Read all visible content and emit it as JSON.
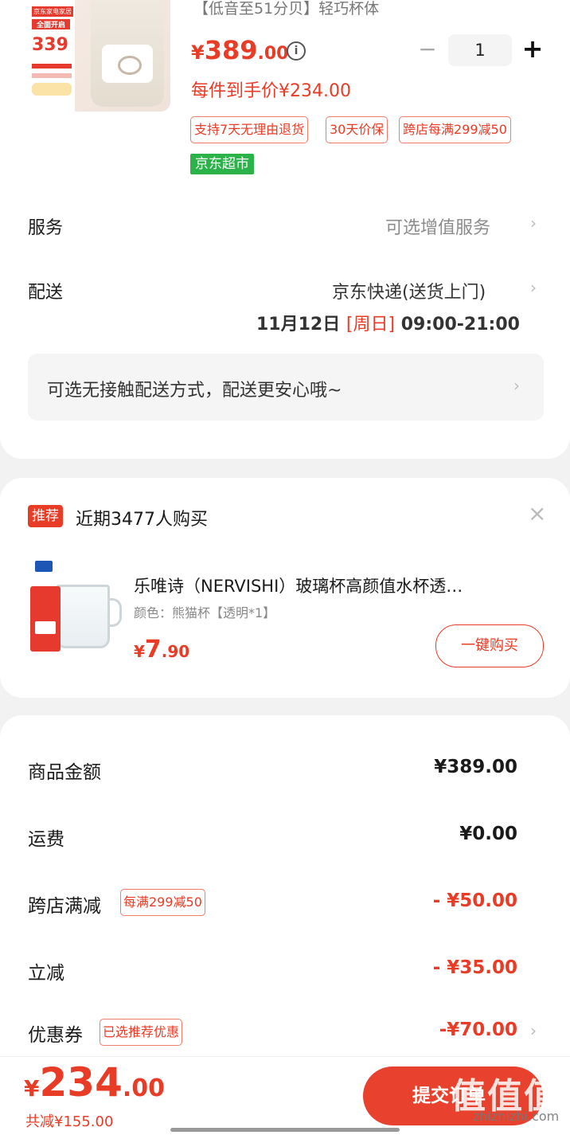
{
  "product": {
    "thumb_badges": [
      "京东家电家居",
      "全面开启",
      "339"
    ],
    "name_tail": "【低音至51分贝】轻巧杯体",
    "price_currency": "¥",
    "price_int": "389",
    "price_dec": ".00",
    "info_icon": "ⓘ",
    "minus": "−",
    "quantity": "1",
    "plus": "+",
    "unit_price": "每件到手价¥234.00",
    "tags": [
      "支持7天无理由退货",
      "30天价保",
      "跨店每满299减50"
    ],
    "market_tag": "京东超市"
  },
  "service": {
    "label": "服务",
    "value": "可选增值服务",
    "chevron": "›"
  },
  "delivery": {
    "label": "配送",
    "method": "京东快递(送货上门)",
    "date": "11月12日",
    "weekday": "[周日]",
    "time": "09:00-21:00",
    "chevron": "›"
  },
  "no_contact": {
    "text": "可选无接触配送方式，配送更安心哦~",
    "chevron": "›"
  },
  "recommend": {
    "badge": "推荐",
    "title": "近期3477人购买",
    "close": "×",
    "item_title": "乐唯诗（NERVISHI）玻璃杯高颜值水杯透…",
    "item_spec": "颜色：熊猫杯【透明*1】",
    "item_price_cur": "¥",
    "item_price_int": "7",
    "item_price_dec": ".90",
    "buy_button": "一键购买"
  },
  "summary": {
    "goods_label": "商品金额",
    "goods_value": "¥389.00",
    "shipping_label": "运费",
    "shipping_value": "¥0.00",
    "cross_label": "跨店满减",
    "cross_tag": "每满299减50",
    "cross_value": "- ¥50.00",
    "instant_label": "立减",
    "instant_value": "- ¥35.00",
    "coupon_label": "优惠券",
    "coupon_tag": "已选推荐优惠",
    "coupon_value": "-¥70.00",
    "coupon_chevron": "›"
  },
  "footer": {
    "total_cur": "¥",
    "total_int": "234",
    "total_dec": ".00",
    "saved": "共减¥155.00",
    "submit": "提交订单",
    "watermark": "值值值",
    "watermark_sub": "zhizhizhi.com"
  },
  "colors": {
    "accent": "#e83c26",
    "green_tag": "#2bb34a",
    "background": "#f2f2f2"
  }
}
